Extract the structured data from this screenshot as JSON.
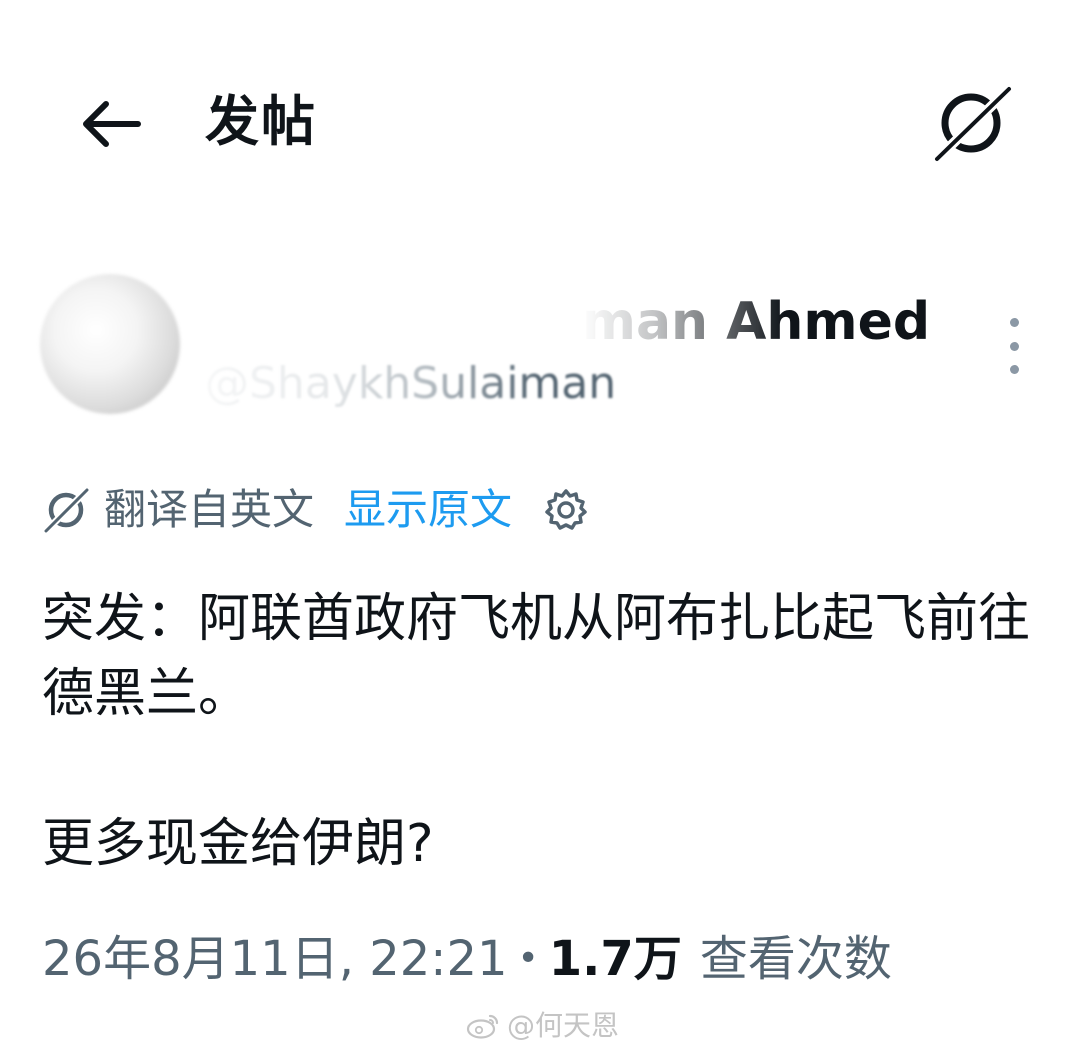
{
  "header": {
    "title": "发帖",
    "back_icon": "arrow-left-icon",
    "translate_icon": "translate-icon"
  },
  "author": {
    "display_name": "Shaykh Sulaiman Ahmed",
    "handle": "@ShaykhSulaiman"
  },
  "translation": {
    "label": "翻译自英文",
    "show_original": "显示原文",
    "settings_icon": "gear-icon"
  },
  "post": {
    "paragraph1": "突发：阿联酋政府飞机从阿布扎比起飞前往德黑兰。",
    "paragraph2": "更多现金给伊朗?"
  },
  "meta": {
    "timestamp": "26年8月11日, 22:21",
    "separator": "•",
    "view_count": "1.7万",
    "views_label": "查看次数"
  },
  "watermark": {
    "text": "@何天恩"
  },
  "colors": {
    "text": "#0f1419",
    "secondary": "#536471",
    "link": "#1d9bf0",
    "watermark": "#c4c4c4"
  }
}
